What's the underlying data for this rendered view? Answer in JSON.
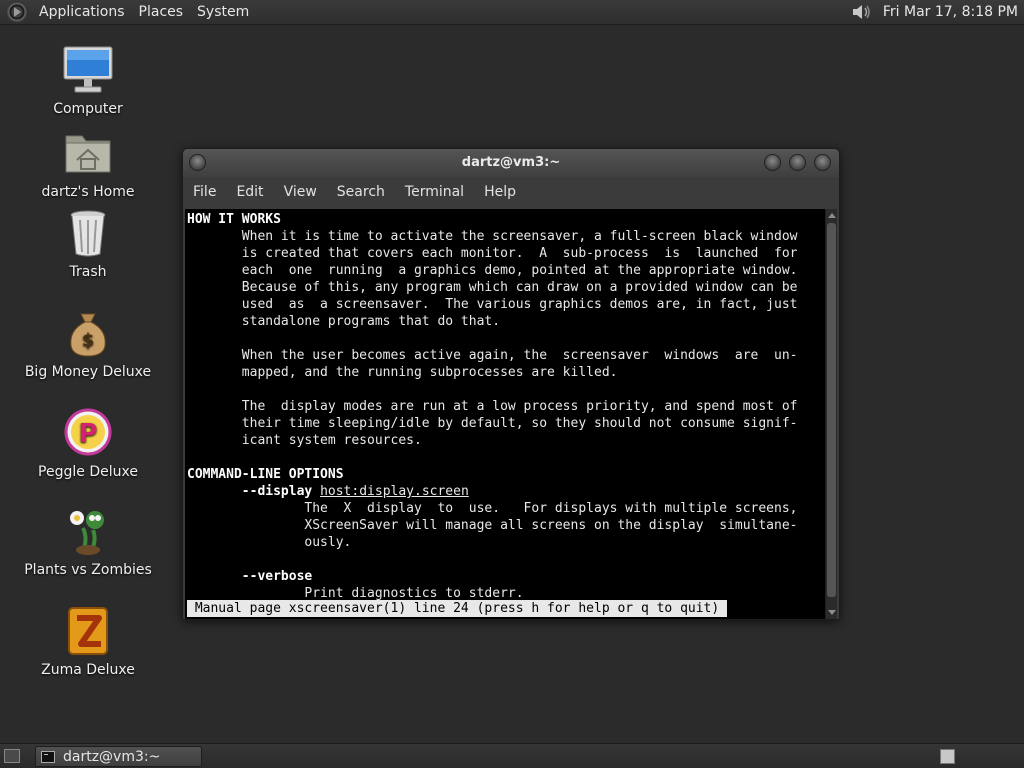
{
  "top_panel": {
    "menus": [
      "Applications",
      "Places",
      "System"
    ],
    "clock": "Fri Mar 17,  8:18 PM",
    "icons": {
      "logo": "distro-logo-icon",
      "volume": "volume-icon"
    }
  },
  "desktop": {
    "icons": [
      {
        "label": "Computer",
        "icon": "computer-icon"
      },
      {
        "label": "dartz's Home",
        "icon": "home-folder-icon"
      },
      {
        "label": "Trash",
        "icon": "trash-icon"
      },
      {
        "label": "Big Money Deluxe",
        "icon": "money-bag-icon"
      },
      {
        "label": "Peggle Deluxe",
        "icon": "peggle-icon"
      },
      {
        "label": "Plants vs Zombies",
        "icon": "plants-vs-zombies-icon"
      },
      {
        "label": "Zuma Deluxe",
        "icon": "zuma-icon"
      }
    ]
  },
  "window": {
    "title": "dartz@vm3:~",
    "menus": [
      "File",
      "Edit",
      "View",
      "Search",
      "Terminal",
      "Help"
    ],
    "terminal": {
      "lines": [
        "HOW IT WORKS",
        "       When it is time to activate the screensaver, a full-screen black window",
        "       is created that covers each monitor.  A  sub-process  is  launched  for",
        "       each  one  running  a graphics demo, pointed at the appropriate window.",
        "       Because of this, any program which can draw on a provided window can be",
        "       used  as  a screensaver.  The various graphics demos are, in fact, just",
        "       standalone programs that do that.",
        "",
        "       When the user becomes active again, the  screensaver  windows  are  un-",
        "       mapped, and the running subprocesses are killed.",
        "",
        "       The  display modes are run at a low process priority, and spend most of",
        "       their time sleeping/idle by default, so they should not consume signif-",
        "       icant system resources.",
        "",
        "COMMAND-LINE OPTIONS",
        "       --display host:display.screen",
        "               The  X  display  to  use.   For displays with multiple screens,",
        "               XScreenSaver will manage all screens on the display  simultane-",
        "               ously.",
        "",
        "       --verbose",
        "               Print diagnostics to stderr."
      ],
      "status": " Manual page xscreensaver(1) line 24 (press h for help or q to quit)"
    }
  },
  "bottom_panel": {
    "task_label": "dartz@vm3:~",
    "icons": {
      "show_desktop": "show-desktop-icon",
      "task": "terminal-icon",
      "workspace": "workspace-switcher-icon"
    }
  },
  "colors": {
    "desktop_bg": "#2b2b2b",
    "terminal_bg": "#000000",
    "terminal_fg": "#e8e8e8",
    "status_bg": "#e8e8e8"
  }
}
